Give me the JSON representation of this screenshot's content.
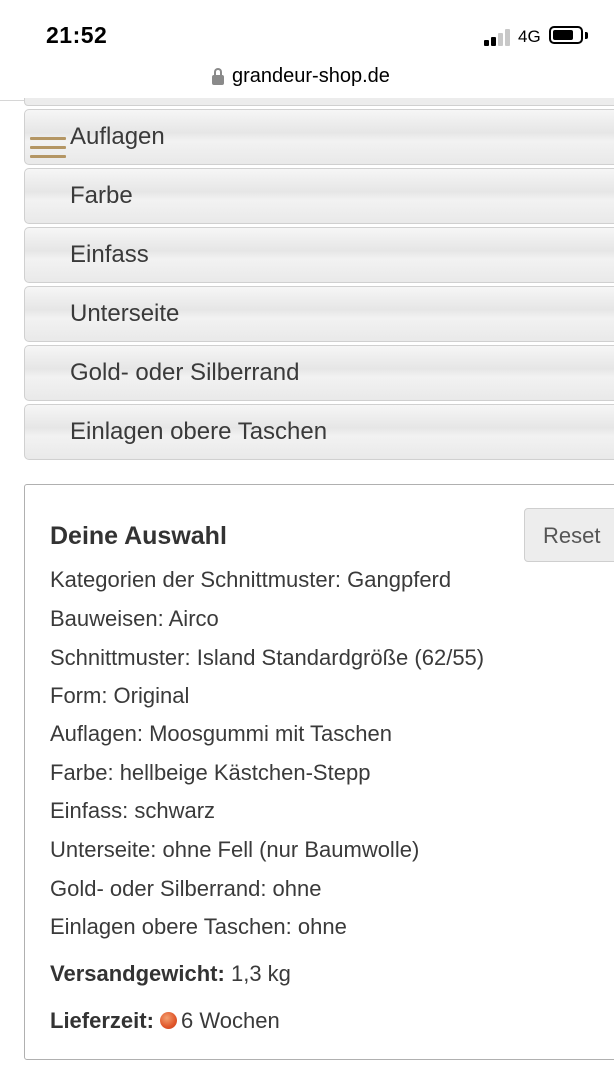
{
  "status_bar": {
    "time": "21:52",
    "network": "4G",
    "battery_level": 0.75
  },
  "browser": {
    "url": "grandeur-shop.de"
  },
  "accordion": [
    {
      "label": "Auflagen"
    },
    {
      "label": "Farbe"
    },
    {
      "label": "Einfass"
    },
    {
      "label": "Unterseite"
    },
    {
      "label": "Gold- oder Silberrand"
    },
    {
      "label": "Einlagen obere Taschen"
    }
  ],
  "selection": {
    "title": "Deine Auswahl",
    "reset_label": "Reset",
    "lines": [
      "Kategorien der Schnittmuster: Gangpferd",
      "Bauweisen: Airco",
      "Schnittmuster: Island Standardgröße (62/55)",
      "Form: Original",
      "Auflagen: Moosgummi mit Taschen",
      "Farbe: hellbeige Kästchen-Stepp",
      "Einfass: schwarz",
      "Unterseite: ohne Fell (nur Baumwolle)",
      "Gold- oder Silberrand: ohne",
      "Einlagen obere Taschen: ohne"
    ],
    "weight_label": "Versandgewicht:",
    "weight_value": "1,3 kg",
    "delivery_label": "Lieferzeit:",
    "delivery_value": "6 Wochen"
  },
  "colors": {
    "accent": "#b49664",
    "delivery_dot": "#e0562a"
  },
  "icons": {
    "menu": "hamburger-icon",
    "lock": "lock-icon",
    "delivery": "status-dot-icon"
  }
}
